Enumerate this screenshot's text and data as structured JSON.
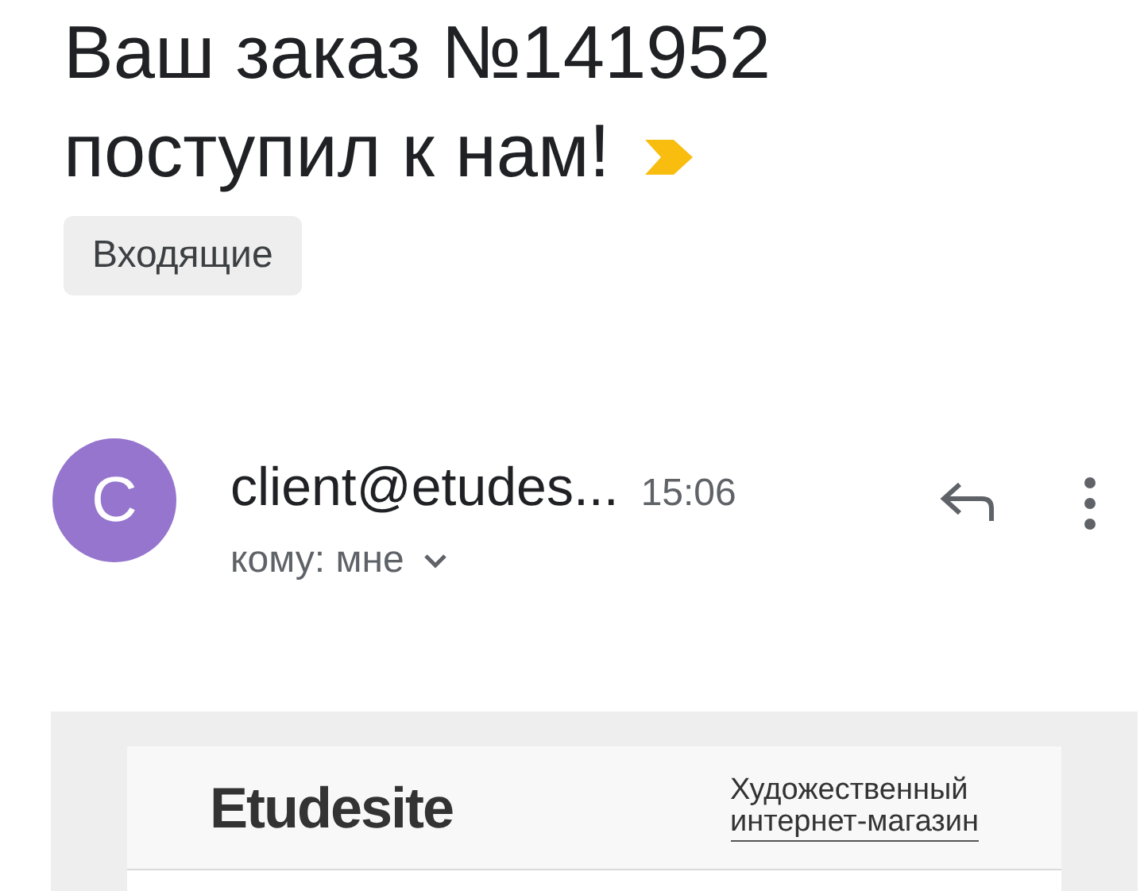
{
  "subject": {
    "title": "Ваш заказ №141952 поступил к нам!",
    "important": true
  },
  "labels": [
    "Входящие"
  ],
  "message": {
    "avatar_letter": "C",
    "sender": "client@etudes...",
    "time": "15:06",
    "recipient": "кому: мне"
  },
  "email_body": {
    "logo": "Etudesite",
    "tagline_line_1": "Художественный",
    "tagline_line_2": "интернет-магазин"
  }
}
